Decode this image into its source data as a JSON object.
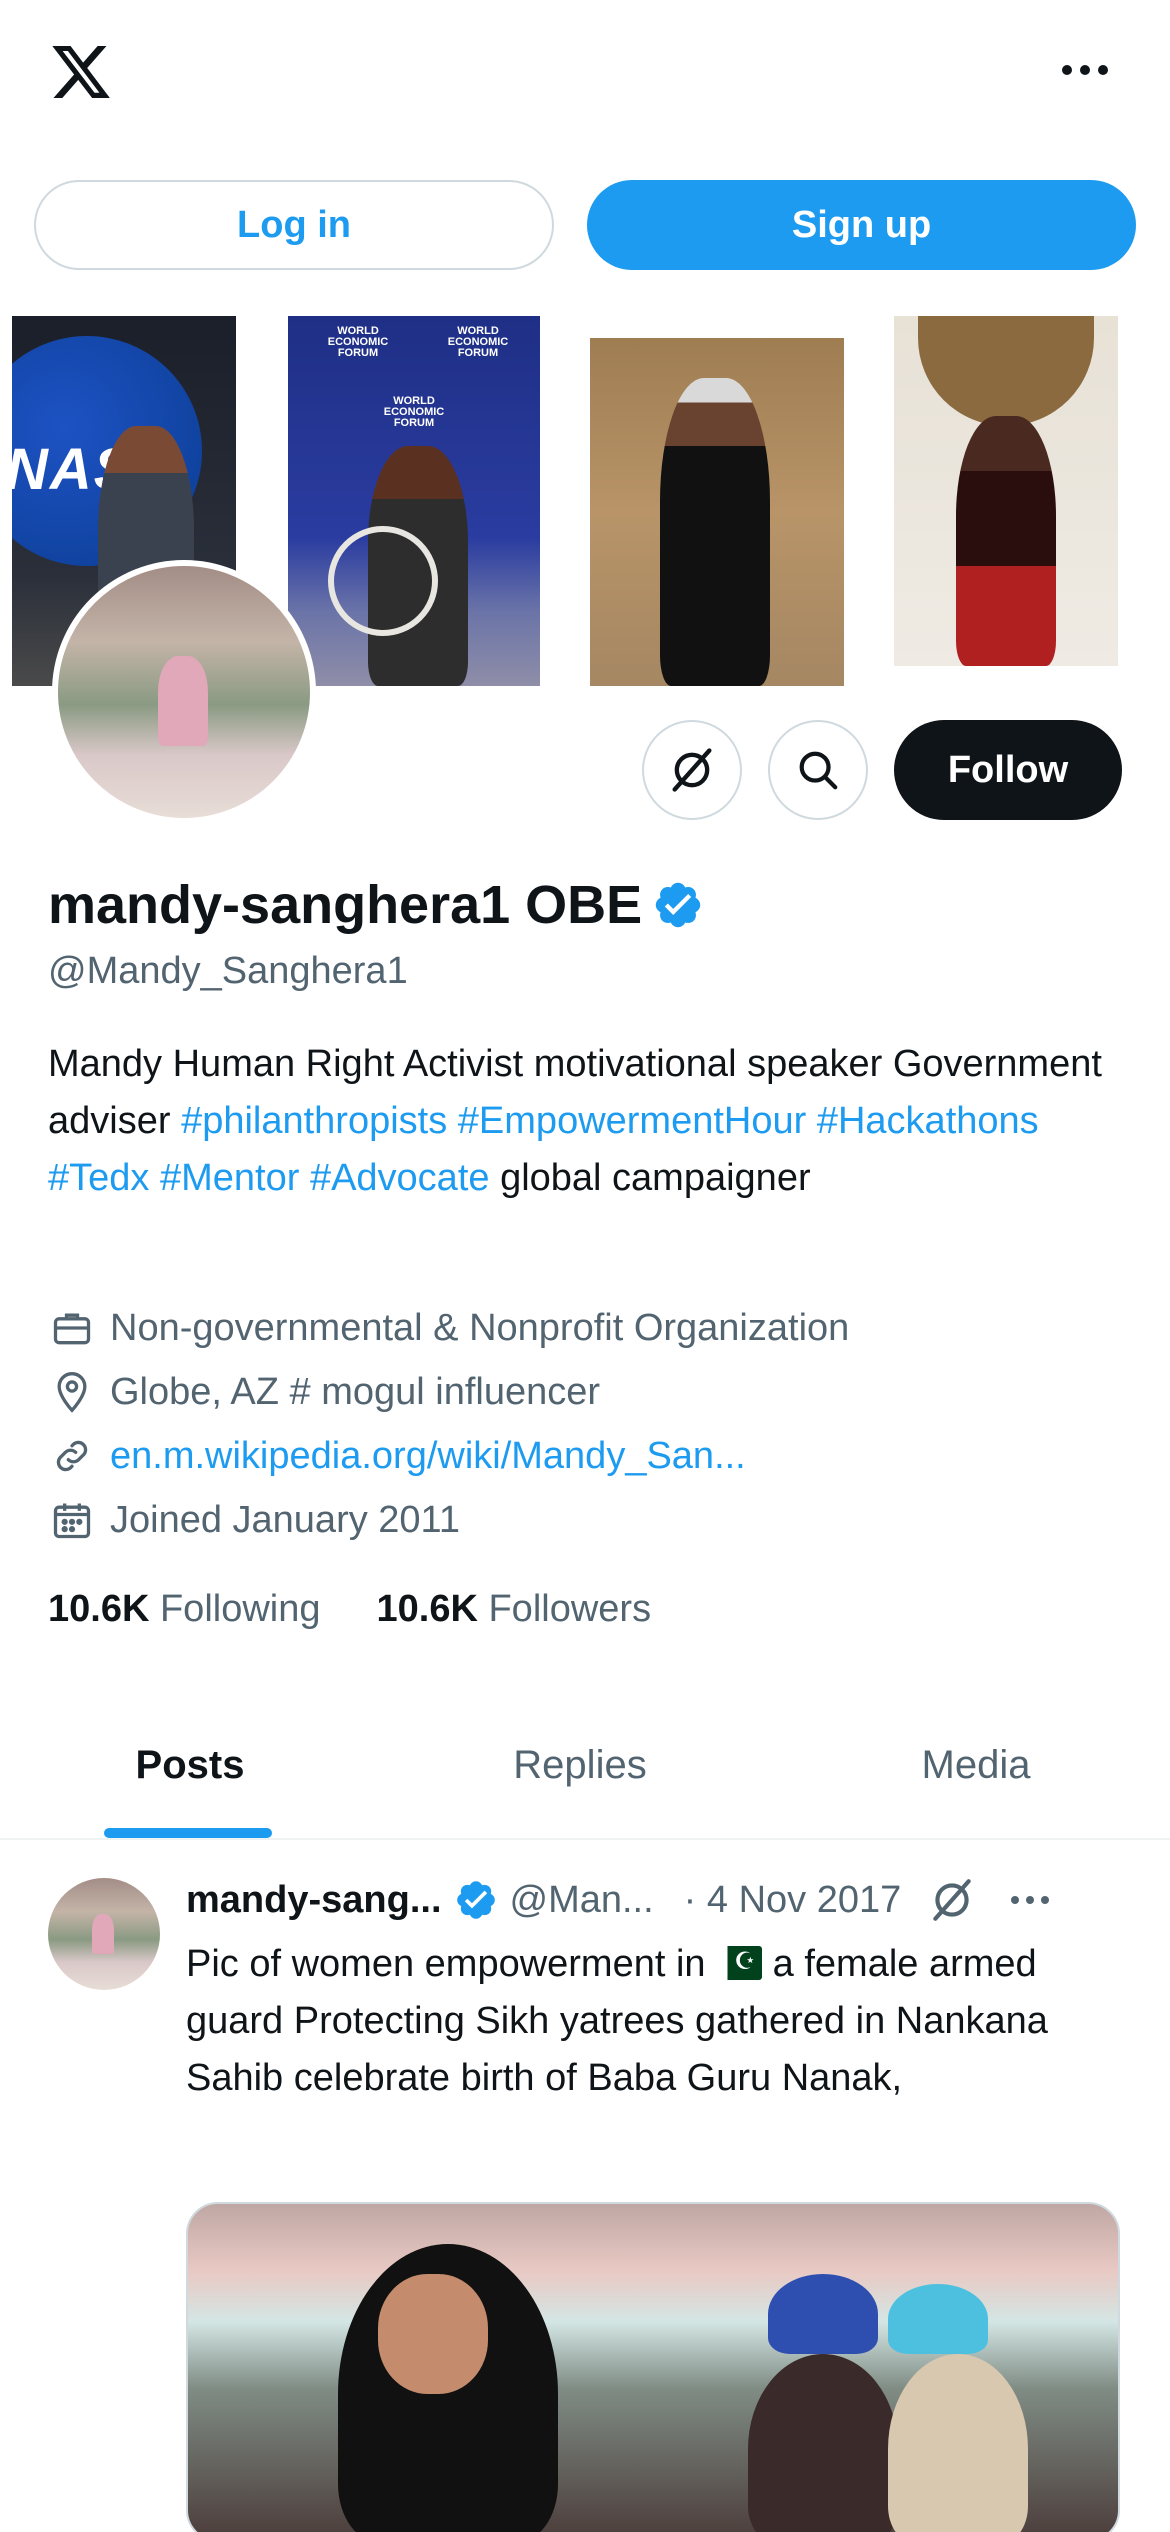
{
  "topbar": {
    "logo_icon": "x-logo-icon",
    "more_icon": "more-horizontal-icon"
  },
  "auth": {
    "login_label": "Log in",
    "signup_label": "Sign up"
  },
  "banner": {
    "panels": [
      {
        "text": "NAS"
      },
      {
        "text": "WORLD ECONOMIC FORUM"
      },
      {
        "text": ""
      },
      {
        "text": ""
      }
    ]
  },
  "profile": {
    "display_name": "mandy-sanghera1 OBE",
    "verified_icon": "verified-badge-icon",
    "handle": "@Mandy_Sanghera1",
    "bio": {
      "part1": "Mandy Human Right Activist motivational speaker Government adviser ",
      "tag1": "#philanthropists",
      "tag2": "#EmpowermentHour",
      "tag3": "#Hackathons",
      "tag4": "#Tedx",
      "tag5": "#Mentor",
      "tag6": "#Advocate",
      "part2": " global campaigner"
    },
    "category": "Non-governmental & Nonprofit Organization",
    "location": "Globe, AZ # mogul influencer",
    "website": "en.m.wikipedia.org/wiki/Mandy_San...",
    "joined": "Joined January 2011",
    "following_count": "10.6K",
    "following_label": "Following",
    "followers_count": "10.6K",
    "followers_label": "Followers"
  },
  "actions": {
    "grok_icon": "grok-icon",
    "search_icon": "search-icon",
    "follow_label": "Follow"
  },
  "tabs": [
    {
      "label": "Posts",
      "active": true
    },
    {
      "label": "Replies",
      "active": false
    },
    {
      "label": "Media",
      "active": false
    }
  ],
  "post": {
    "name": "mandy-sang...",
    "handle": "@Man...",
    "date": "· 4 Nov 2017",
    "text_before_flag": "Pic of women empowerment in ",
    "flag": "🇵🇰",
    "text_after_flag": " a female armed guard Protecting  Sikh yatrees gathered in Nankana Sahib celebrate birth  of Baba Guru Nanak,"
  },
  "colors": {
    "accent": "#1d9bf0",
    "text": "#0f1419",
    "secondary": "#536471",
    "border": "#cfd9de"
  }
}
